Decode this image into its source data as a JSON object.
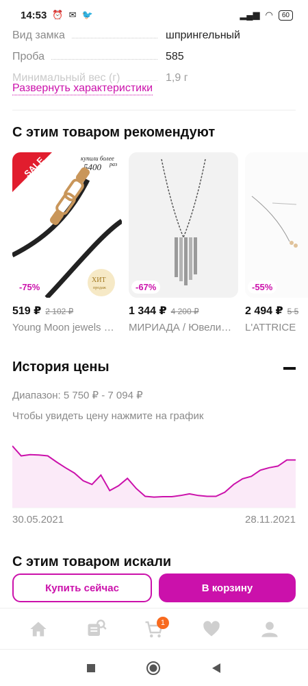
{
  "status": {
    "time": "14:53",
    "battery": "60"
  },
  "specs": {
    "rows": [
      {
        "name": "Вид замка",
        "value": "шпрингельный"
      },
      {
        "name": "Проба",
        "value": "585"
      },
      {
        "name": "Минимальный вес (г)",
        "value": "1,9 г"
      }
    ],
    "expand_label": "Развернуть характеристики"
  },
  "recommend": {
    "title": "С этим товаром рекомендуют",
    "cards": [
      {
        "discount": "-75%",
        "price": "519 ₽",
        "old_price": "2 102 ₽",
        "brand": "Young Moon jewels …",
        "badge": "SALE",
        "bought_text": "купили более",
        "bought_count": "5400",
        "bought_unit": "раз",
        "hit_text": "ХИТ",
        "hit_sub": "продаж"
      },
      {
        "discount": "-67%",
        "price": "1 344 ₽",
        "old_price": "4 200 ₽",
        "brand": "МИРИАДА / Ювели…"
      },
      {
        "discount": "-55%",
        "price": "2 494 ₽",
        "old_price": "5 5",
        "brand": "L'ATTRICE"
      }
    ]
  },
  "price_history": {
    "title": "История цены",
    "range": "Диапазон: 5 750 ₽ - 7 094 ₽",
    "hint": "Чтобы увидеть цену нажмите на график",
    "date_start": "30.05.2021",
    "date_end": "28.11.2021"
  },
  "chart_data": {
    "type": "area",
    "x_start": "30.05.2021",
    "x_end": "28.11.2021",
    "ylim": [
      5750,
      7094
    ],
    "color": "#cb11ab",
    "fill": "#fbeaf8",
    "values": [
      7094,
      6850,
      6880,
      6870,
      6850,
      6700,
      6560,
      6430,
      6240,
      6150,
      6380,
      6000,
      6120,
      6300,
      6050,
      5860,
      5840,
      5850,
      5850,
      5880,
      5920,
      5880,
      5860,
      5860,
      5960,
      6150,
      6290,
      6350,
      6500,
      6560,
      6600,
      6750,
      6750
    ]
  },
  "search": {
    "title": "С этим товаром искали"
  },
  "actions": {
    "buy_now": "Купить сейчас",
    "add_to_cart": "В корзину"
  },
  "tabbar": {
    "cart_count": "1",
    "icons": [
      "home-icon",
      "catalog-search-icon",
      "cart-icon",
      "heart-icon",
      "profile-icon"
    ]
  },
  "colors": {
    "accent": "#cb11ab",
    "badge": "#f86a1e"
  }
}
